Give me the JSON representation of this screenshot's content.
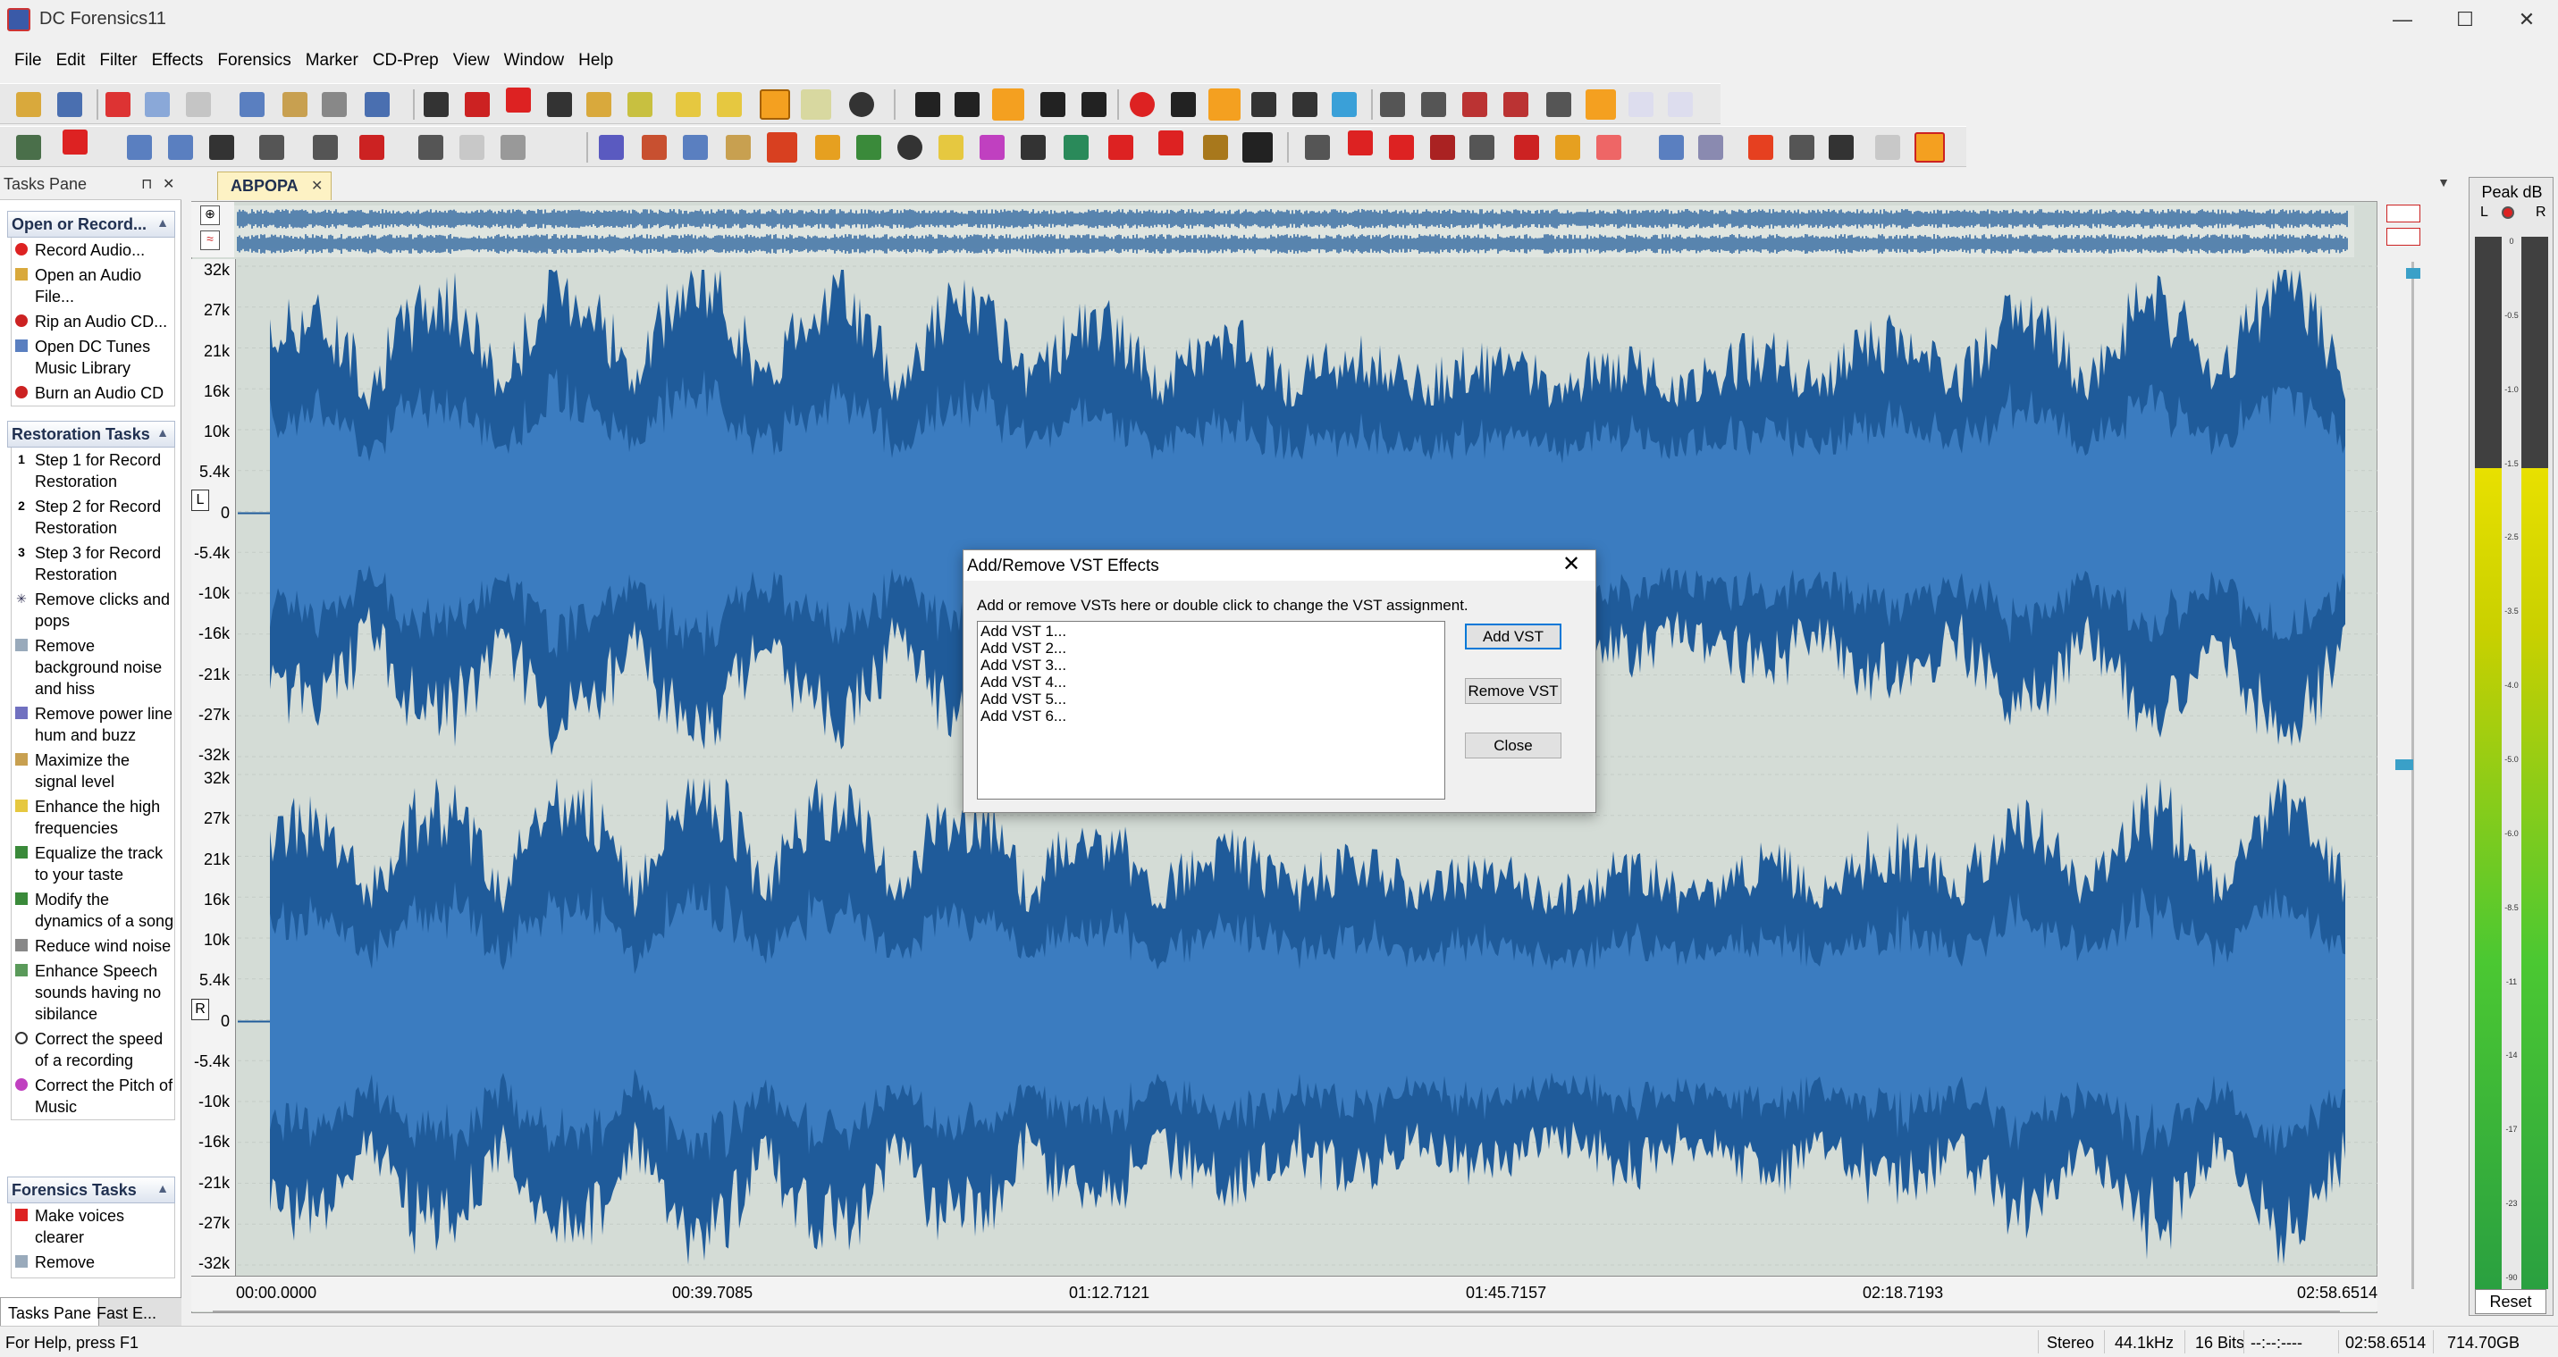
{
  "window": {
    "title": "DC Forensics11",
    "minimize": "—",
    "maximize": "☐",
    "close": "✕"
  },
  "menu": [
    "File",
    "Edit",
    "Filter",
    "Effects",
    "Forensics",
    "Marker",
    "CD-Prep",
    "View",
    "Window",
    "Help"
  ],
  "tasks_pane": {
    "header": "Tasks Pane",
    "pin": "⊓",
    "close": "✕",
    "sections": [
      {
        "title": "Open or Record...",
        "items": [
          {
            "label": "Record Audio...",
            "icon": "record-icon"
          },
          {
            "label": "Open an Audio File...",
            "icon": "open-folder-icon"
          },
          {
            "label": "Rip an Audio CD...",
            "icon": "cd-rip-icon"
          },
          {
            "label": "Open DC Tunes Music Library",
            "icon": "library-icon"
          },
          {
            "label": "Burn an Audio CD",
            "icon": "burn-cd-icon"
          }
        ]
      },
      {
        "title": "Restoration Tasks",
        "items": [
          {
            "label": "Step 1 for Record Restoration",
            "icon": "step-1-icon",
            "glyph": "1"
          },
          {
            "label": "Step 2 for Record Restoration",
            "icon": "step-2-icon",
            "glyph": "2"
          },
          {
            "label": "Step 3 for Record Restoration",
            "icon": "step-3-icon",
            "glyph": "3"
          },
          {
            "label": "Remove clicks and pops",
            "icon": "declick-icon"
          },
          {
            "label": "Remove background noise and hiss",
            "icon": "noise-icon"
          },
          {
            "label": "Remove power line hum and buzz",
            "icon": "hum-icon"
          },
          {
            "label": "Maximize the signal level",
            "icon": "maximize-icon"
          },
          {
            "label": "Enhance the high frequencies",
            "icon": "enhance-icon"
          },
          {
            "label": "Equalize the track to your taste",
            "icon": "equalizer-icon"
          },
          {
            "label": "Modify the dynamics of a song",
            "icon": "dynamics-icon"
          },
          {
            "label": "Reduce wind noise",
            "icon": "wind-icon"
          },
          {
            "label": "Enhance Speech sounds having no sibilance",
            "icon": "speech-icon"
          },
          {
            "label": "Correct the speed of a recording",
            "icon": "speed-icon"
          },
          {
            "label": "Correct the Pitch of Music",
            "icon": "pitch-icon"
          }
        ]
      },
      {
        "title": "Forensics Tasks",
        "items": [
          {
            "label": "Make voices clearer",
            "icon": "voice-icon"
          },
          {
            "label": "Remove",
            "icon": "remove-icon"
          }
        ]
      }
    ],
    "tabs": [
      "Tasks Pane",
      "Fast E..."
    ]
  },
  "document": {
    "tab_label": "ABPOPA",
    "tab_close": "✕",
    "y_labels": [
      "32k",
      "27k",
      "21k",
      "16k",
      "10k",
      "5.4k",
      "0",
      "-5.4k",
      "-10k",
      "-16k",
      "-21k",
      "-27k",
      "-32k"
    ],
    "channel_left": "L",
    "channel_right": "R",
    "timeline": [
      "00:00.0000",
      "00:39.7085",
      "01:12.7121",
      "01:45.7157",
      "02:18.7193",
      "02:58.6514"
    ]
  },
  "peak_meter": {
    "title": "Peak dB",
    "left": "L",
    "right": "R",
    "scale": [
      "0",
      "-0.5",
      "-1.0",
      "-1.5",
      "-2.5",
      "-3.5",
      "-4.0",
      "-5.0",
      "-6.0",
      "-8.5",
      "-11",
      "-14",
      "-17",
      "-23",
      "-90"
    ],
    "left_level": 0.78,
    "right_level": 0.78,
    "reset": "Reset"
  },
  "status": {
    "help": "For Help, press F1",
    "channels": "Stereo",
    "rate": "44.1kHz",
    "bits": "16 Bits",
    "position": "--:--:----",
    "length": "02:58.6514",
    "disk": "714.70GB"
  },
  "dialog": {
    "title": "Add/Remove VST Effects",
    "close": "✕",
    "instructions": "Add or remove VSTs here or double click to change the VST assignment.",
    "items": [
      "Add VST 1...",
      "Add VST 2...",
      "Add VST 3...",
      "Add VST 4...",
      "Add VST 5...",
      "Add VST 6..."
    ],
    "add_button": "Add VST",
    "remove_button": "Remove VST",
    "close_button": "Close"
  },
  "colors": {
    "waveform": "#1f5b9a",
    "waveform_core": "#3b7cc0",
    "wave_bg": "#d4dcd6",
    "accent": "#0078d7"
  }
}
